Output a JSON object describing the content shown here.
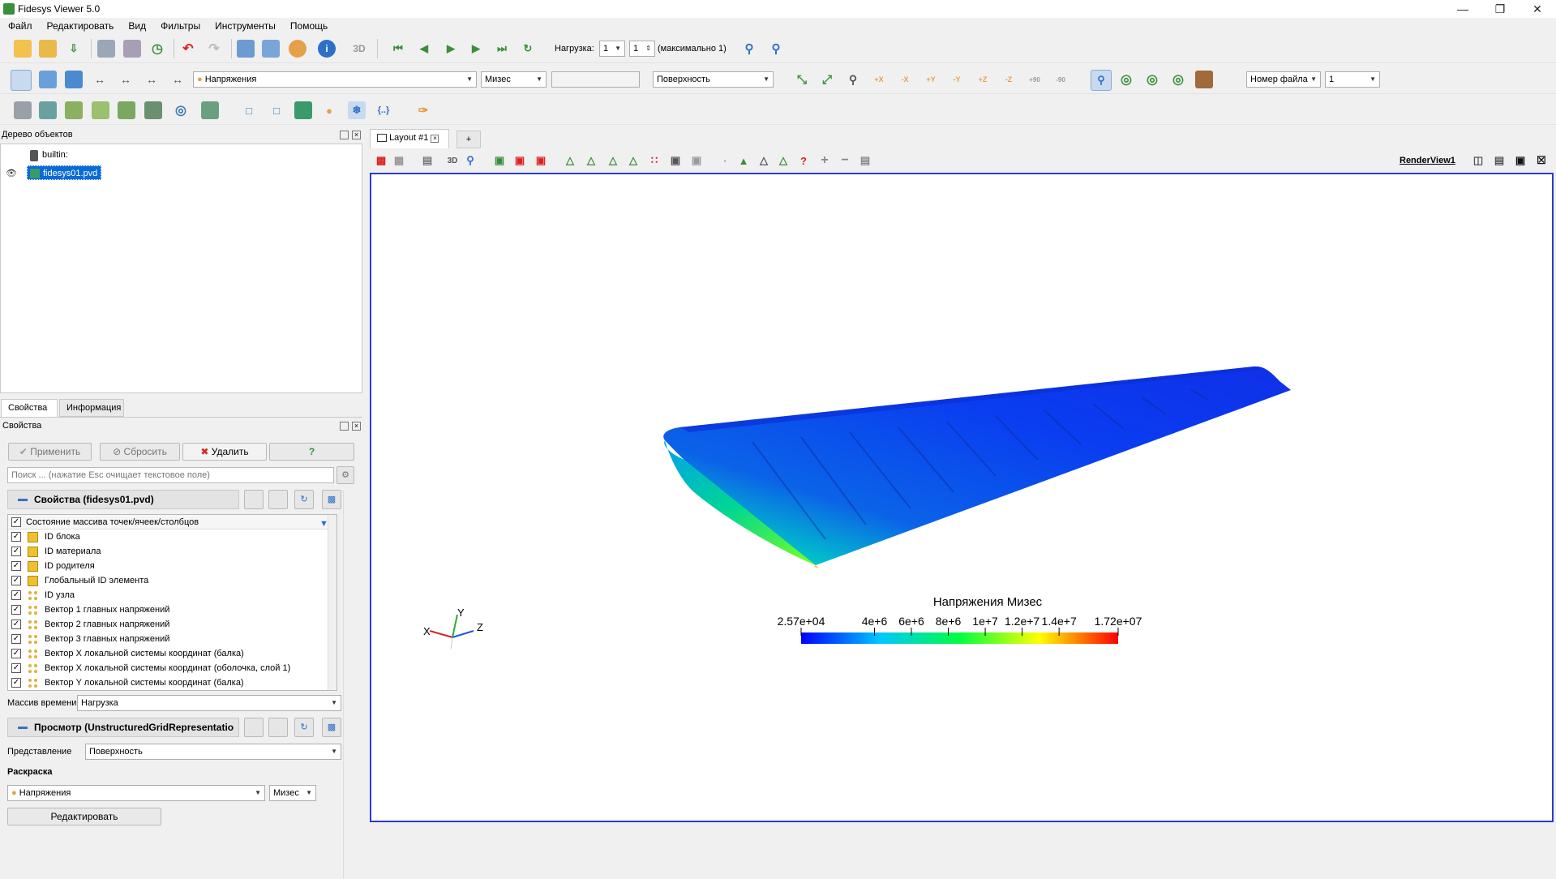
{
  "window": {
    "title": "Fidesys Viewer 5.0"
  },
  "menu": [
    "Файл",
    "Редактировать",
    "Вид",
    "Фильтры",
    "Инструменты",
    "Помощь"
  ],
  "toolbar1": {
    "load_label": "Нагрузка:",
    "load_value": "1",
    "load_step": "1",
    "load_max": "(максимально 1)"
  },
  "toolbar2": {
    "field": "Напряжения",
    "component": "Мизес",
    "representation": "Поверхность",
    "file_label": "Номер файла",
    "file_value": "1",
    "rot_plus": "+90",
    "rot_minus": "-90"
  },
  "tree": {
    "title": "Дерево объектов",
    "root": "builtin:",
    "item": "fidesys01.pvd"
  },
  "tabs_left": [
    "Свойства",
    "Информация"
  ],
  "props": {
    "title": "Свойства",
    "apply": "Применить",
    "reset": "Сбросить",
    "delete": "Удалить",
    "help": "?",
    "search_placeholder": "Поиск ... (нажатие Esc очищает текстовое поле)",
    "group1": "Свойства (fidesys01.pvd)",
    "arrays_header": "Состояние массива точек/ячеек/столбцов",
    "arrays": [
      {
        "name": "ID блока",
        "kind": "cell"
      },
      {
        "name": "ID материала",
        "kind": "cell"
      },
      {
        "name": "ID родителя",
        "kind": "cell"
      },
      {
        "name": "Глобальный ID элемента",
        "kind": "cell"
      },
      {
        "name": "ID узла",
        "kind": "point"
      },
      {
        "name": "Вектор 1 главных напряжений",
        "kind": "point"
      },
      {
        "name": "Вектор 2 главных напряжений",
        "kind": "point"
      },
      {
        "name": "Вектор 3 главных напряжений",
        "kind": "point"
      },
      {
        "name": "Вектор X локальной системы координат (балка)",
        "kind": "point"
      },
      {
        "name": "Вектор X локальной системы координат (оболочка, слой 1)",
        "kind": "point"
      },
      {
        "name": "Вектор Y локальной системы координат (балка)",
        "kind": "point"
      }
    ],
    "time_label": "Массив времени",
    "time_value": "Нагрузка",
    "group2": "Просмотр (UnstructuredGridRepresentatio",
    "repr_label": "Представление",
    "repr_value": "Поверхность",
    "coloring_label": "Раскраска",
    "coloring_field": "Напряжения",
    "coloring_comp": "Мизес",
    "edit_label": "Редактировать"
  },
  "layout": {
    "tab": "Layout #1",
    "plus": "+",
    "view_name": "RenderView1",
    "btn_3d": "3D"
  },
  "colorbar": {
    "title": "Напряжения Мизес",
    "min": 25700,
    "max": 17200000,
    "tick_values": [
      25700,
      4000000,
      6000000,
      8000000,
      10000000,
      12000000,
      14000000,
      17200000
    ],
    "tick_labels": [
      "2.57e+04",
      "4e+6",
      "6e+6",
      "8e+6",
      "1e+7",
      "1.2e+7",
      "1.4e+7",
      "1.72e+07"
    ],
    "colors": [
      "#0000ff",
      "#00c8ff",
      "#00ff40",
      "#ffff00",
      "#ff0000"
    ]
  },
  "axes": {
    "x": "X",
    "y": "Y",
    "z": "Z"
  }
}
